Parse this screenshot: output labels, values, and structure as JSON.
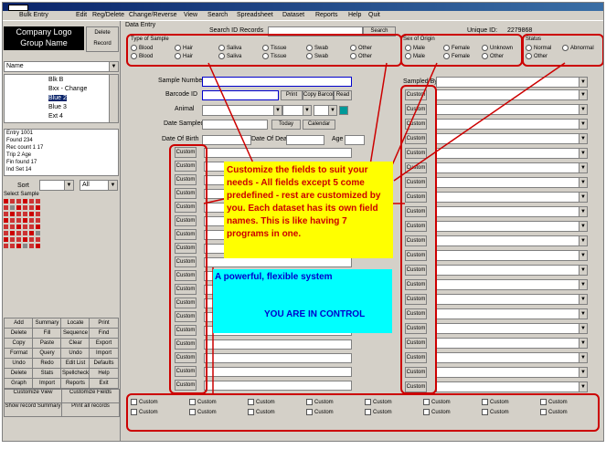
{
  "titlebar": {
    "menus": [
      "Bulk Entry",
      "Edit",
      "Reg/Delete",
      "Change/Reverse",
      "View",
      "Search",
      "Spreadsheet",
      "Dataset",
      "Reports",
      "Help",
      "Quit"
    ]
  },
  "left": {
    "group_title_line1": "Company Logo",
    "group_title_line2": "Group Name",
    "delete_btn": "Delete Record",
    "dataset_combo": "Name",
    "list_items": [
      "Blk B",
      "Bxx - Change",
      "Blue 2",
      "Blue 3",
      "Ext 4"
    ],
    "stats": [
      "Entry 1001",
      "Found 234",
      "Rec count 1 17",
      "Trip 2 Age",
      "Fin found 17",
      "Ind Set 14"
    ],
    "sort_label": "Sort",
    "sort_value": "All",
    "select_label": "Select Sample",
    "buttons": [
      "Add",
      "Summary",
      "Locate",
      "Print",
      "Delete",
      "Fill",
      "Sequence",
      "Find",
      "Copy",
      "Paste",
      "Clear",
      "Export",
      "Format",
      "Query",
      "Undo",
      "Import",
      "Undo",
      "Redo",
      "Edit List",
      "Defaults",
      "Delete",
      "Stats",
      "Spellcheck",
      "Help",
      "Graph",
      "Import",
      "Reports",
      "Exit"
    ],
    "big_buttons": [
      "Customize View",
      "Customize Fields",
      "Show record Summary",
      "Print all records"
    ]
  },
  "main": {
    "tab_label": "Data Entry",
    "search_label": "Search ID Records",
    "search_btn": "Search",
    "unique_id_label": "Unique ID:",
    "unique_id_value": "2279868",
    "type_sample_label": "Type of Sample",
    "type_radios": [
      "Blood",
      "Hair",
      "Saliva",
      "Tissue",
      "Swab",
      "Other",
      "Blood",
      "Hair",
      "Saliva",
      "Tissue",
      "Swab",
      "Other"
    ],
    "sex_label": "Sex of Origin",
    "sex_radios": [
      "Male",
      "Female",
      "Unknown",
      "Male",
      "Female",
      "Other"
    ],
    "status_label": "Status",
    "status_radios": [
      "Normal",
      "Abnormal",
      "Other"
    ],
    "fields": {
      "sample_number": "Sample Number",
      "barcode": "Barcode ID",
      "animal": "Animal",
      "date_sampled": "Date Sampled",
      "date_of_birth": "Date Of Birth",
      "date_of_death": "Date Of Death",
      "age": "Age",
      "sampled_by": "Sampled By"
    },
    "barcode_btns": [
      "Print",
      "Copy Barcode",
      "Read"
    ],
    "date_btns": [
      "Today",
      "Calendar"
    ],
    "custom_label": "Custom",
    "yellow_text": "Customize the fields to suit your needs - All fields except 5 come predefined - rest are customized by you. Each dataset has its own field names. This is like having 7 programs in one.",
    "cyan_line1": "A powerful, flexible system",
    "cyan_line2": "YOU ARE IN CONTROL"
  },
  "colors": {
    "annotation_red": "#cc0000",
    "yellow_callout": "#ffff00",
    "cyan_callout": "#00ffff",
    "title_blue": "#0a246a"
  }
}
